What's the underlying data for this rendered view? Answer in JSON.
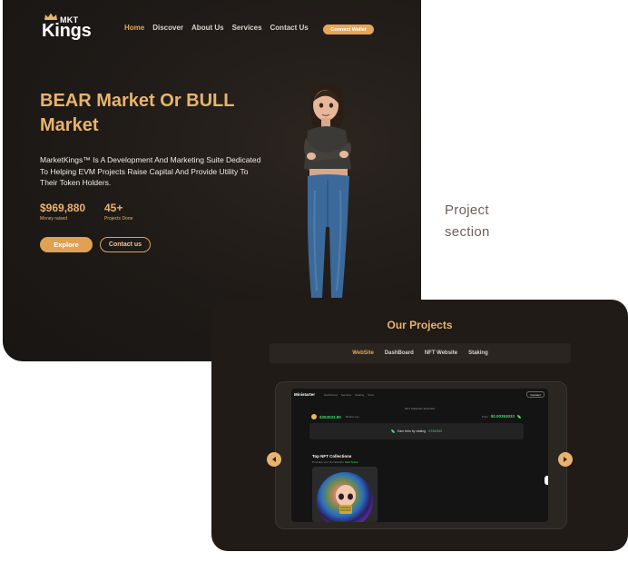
{
  "hero": {
    "logo": {
      "top": "MKT",
      "main": "Kings"
    },
    "nav": [
      {
        "label": "Home",
        "active": true
      },
      {
        "label": "Discover",
        "active": false
      },
      {
        "label": "About Us",
        "active": false
      },
      {
        "label": "Services",
        "active": false
      },
      {
        "label": "Contact Us",
        "active": false
      }
    ],
    "connect_label": "Connect Wallet",
    "title_line1": "BEAR Market Or BULL",
    "title_line2": "Market",
    "description": "MarketKings™ Is A Development And Marketing Suite Dedicated To Helping EVM Projects Raise Capital And Provide Utility To Their Token Holders.",
    "stats": [
      {
        "value": "$969,880",
        "label": "Money raised"
      },
      {
        "value": "45+",
        "label": "Projects Done"
      }
    ],
    "explore_label": "Explore",
    "contact_label": "Contact us"
  },
  "side_label": {
    "line1": "Project",
    "line2": "section"
  },
  "projects": {
    "title": "Our Projects",
    "tabs": [
      {
        "label": "WebSite",
        "active": true
      },
      {
        "label": "DashBoard",
        "active": false
      },
      {
        "label": "NFT Website",
        "active": false
      },
      {
        "label": "Staking",
        "active": false
      }
    ],
    "screen": {
      "brand": "Ministarter",
      "nav": [
        "Dashboard",
        "Services",
        "Staking",
        "Docs"
      ],
      "connect": "Connect",
      "top_label": "NFT Collection launched",
      "left_value": "$353033.90",
      "left_label": "Market cap",
      "right_label": "Price",
      "right_value": "$0.00353033",
      "earn_text": "Earn fees by visiting",
      "earn_link": "STAKING",
      "collections_title": "Top NFT Collections",
      "collections_sub": "Provides you nft collection",
      "collections_link": "Hold Tether"
    }
  },
  "colors": {
    "accent": "#e8b36e",
    "positive": "#3ddc6a",
    "card_bg": "#1e1a17"
  }
}
